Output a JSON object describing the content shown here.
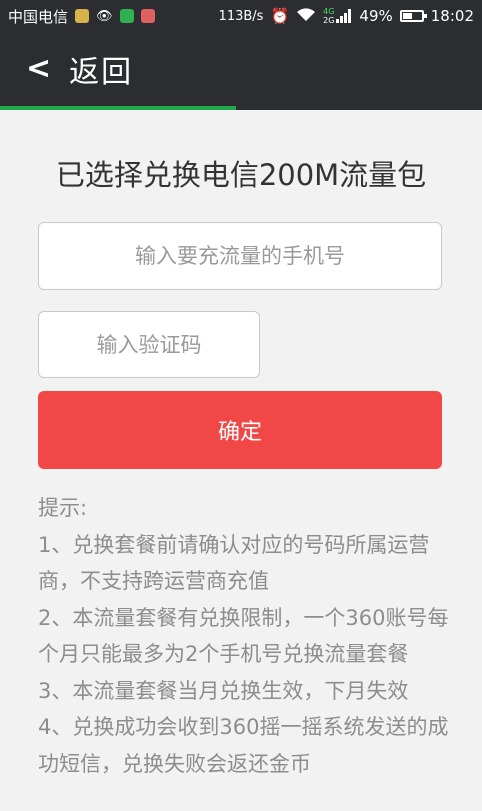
{
  "status_bar": {
    "carrier": "中国电信",
    "speed": "113B/s",
    "network_4g": "4G",
    "network_2g": "2G",
    "battery_percent": "49%",
    "time": "18:02"
  },
  "nav": {
    "back_label": "返回"
  },
  "progress": {
    "fraction": 0.49,
    "color": "#1fa84a"
  },
  "main": {
    "title": "已选择兑换电信200M流量包",
    "phone_placeholder": "输入要充流量的手机号",
    "code_placeholder": "输入验证码",
    "confirm_label": "确定"
  },
  "tips": {
    "heading": "提示:",
    "items": [
      "1、兑换套餐前请确认对应的号码所属运营商，不支持跨运营商充值",
      "2、本流量套餐有兑换限制，一个360账号每个月只能最多为2个手机号兑换流量套餐",
      "3、本流量套餐当月兑换生效，下月失效",
      "4、兑换成功会收到360摇一摇系统发送的成功短信，兑换失败会返还金币"
    ]
  },
  "colors": {
    "header_bg": "#2b2d31",
    "page_bg": "#f2f2f2",
    "confirm_bg": "#f14746",
    "tips_text": "#8d8d8d"
  }
}
